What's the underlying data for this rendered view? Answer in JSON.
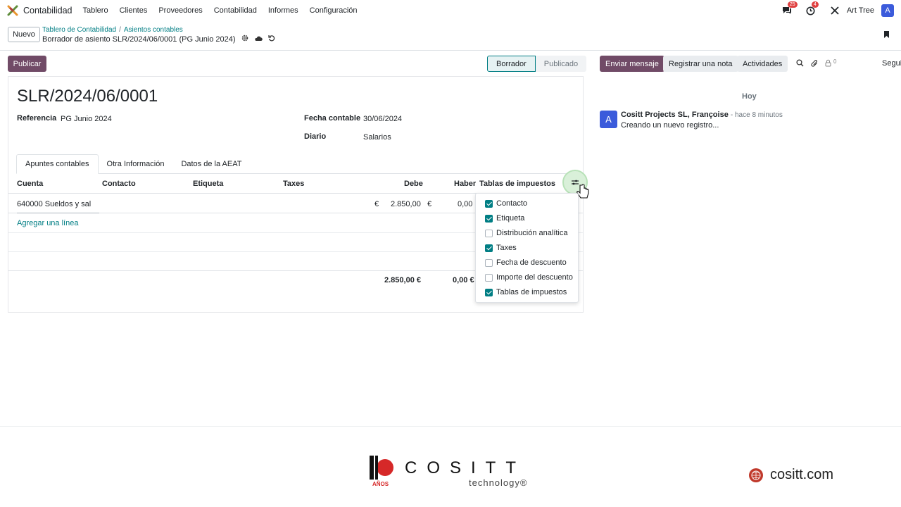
{
  "navbar": {
    "app_name": "Contabilidad",
    "menu": [
      "Tablero",
      "Clientes",
      "Proveedores",
      "Contabilidad",
      "Informes",
      "Configuración"
    ],
    "messages_count": "25",
    "activities_count": "4",
    "company": "Art Tree",
    "user_initial": "A"
  },
  "control": {
    "new_label": "Nuevo",
    "breadcrumb": [
      "Tablero de Contabilidad",
      "Asientos contables"
    ],
    "breadcrumb_sep": "/",
    "record_title": "Borrador de asiento SLR/2024/06/0001 (PG Junio 2024)"
  },
  "form": {
    "publish_label": "Publicar",
    "status": [
      "Borrador",
      "Publicado"
    ],
    "name": "SLR/2024/06/0001",
    "ref_label": "Referencia",
    "ref_value": "PG Junio 2024",
    "date_label": "Fecha contable",
    "date_value": "30/06/2024",
    "journal_label": "Diario",
    "journal_value": "Salarios",
    "tabs": [
      "Apuntes contables",
      "Otra Información",
      "Datos de la AEAT"
    ]
  },
  "table": {
    "headers": [
      "Cuenta",
      "Contacto",
      "Etiqueta",
      "Taxes",
      "Debe",
      "Haber",
      "Tablas de impuestos"
    ],
    "rows": [
      {
        "account": "640000 Sueldos y sal",
        "cur1": "€",
        "debit": "2.850,00",
        "cur2": "€",
        "credit": "0,00"
      }
    ],
    "add_line": "Agregar una línea",
    "total_debit": "2.850,00 €",
    "total_credit": "0,00 €"
  },
  "column_options": [
    {
      "label": "Contacto",
      "checked": true
    },
    {
      "label": "Etiqueta",
      "checked": true
    },
    {
      "label": "Distribución analítica",
      "checked": false
    },
    {
      "label": "Taxes",
      "checked": true
    },
    {
      "label": "Fecha de descuento",
      "checked": false
    },
    {
      "label": "Importe del descuento",
      "checked": false
    },
    {
      "label": "Tablas de impuestos",
      "checked": true
    }
  ],
  "chatter": {
    "send_label": "Enviar mensaje",
    "note_label": "Registrar una nota",
    "activities_label": "Actividades",
    "attachments_count": "0",
    "follow_label": "Segui",
    "today_label": "Hoy",
    "message": {
      "avatar": "A",
      "author": "Cositt Projects SL, Françoise",
      "time": "- hace 8 minutos",
      "body": "Creando un nuevo registro..."
    }
  },
  "footer": {
    "logo_number": "10",
    "logo_years": "AÑOS",
    "brand": "COSITT",
    "tagline": "technology®",
    "website": "cositt.com"
  },
  "colors": {
    "primary": "#714b67",
    "accent": "#017e84",
    "avatar": "#3b5bdb"
  }
}
